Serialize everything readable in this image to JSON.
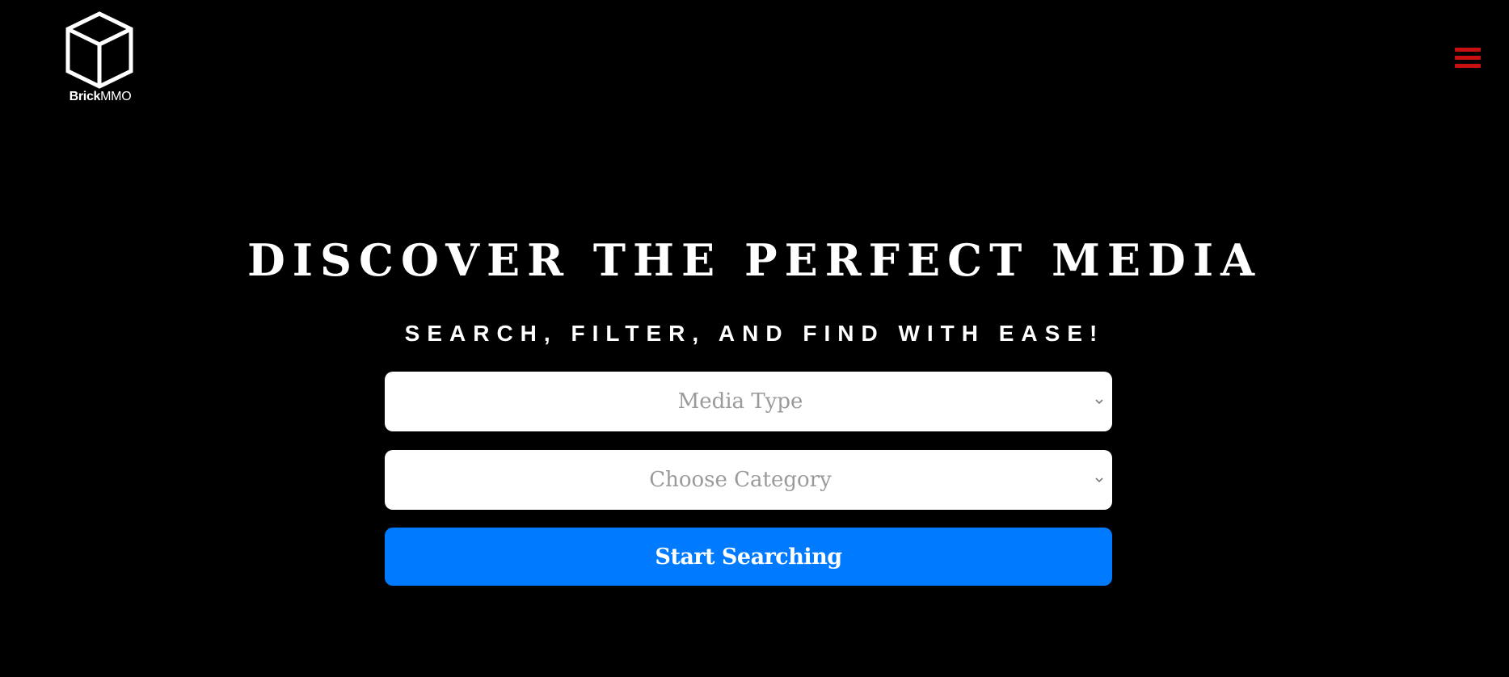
{
  "brand": {
    "logo_icon": "cube-icon",
    "name_bold": "Brick",
    "name_regular": "MMO"
  },
  "nav": {
    "menu_icon": "hamburger-menu-icon"
  },
  "hero": {
    "title": "DISCOVER THE PERFECT MEDIA",
    "subtitle": "SEARCH, FILTER, AND FIND WITH EASE!"
  },
  "form": {
    "media_type_placeholder": "Media Type",
    "category_placeholder": "Choose Category",
    "submit_label": "Start Searching"
  },
  "colors": {
    "background": "#000000",
    "accent": "#c81010",
    "primary": "#007bff",
    "placeholder_text": "#9a9a9a"
  }
}
